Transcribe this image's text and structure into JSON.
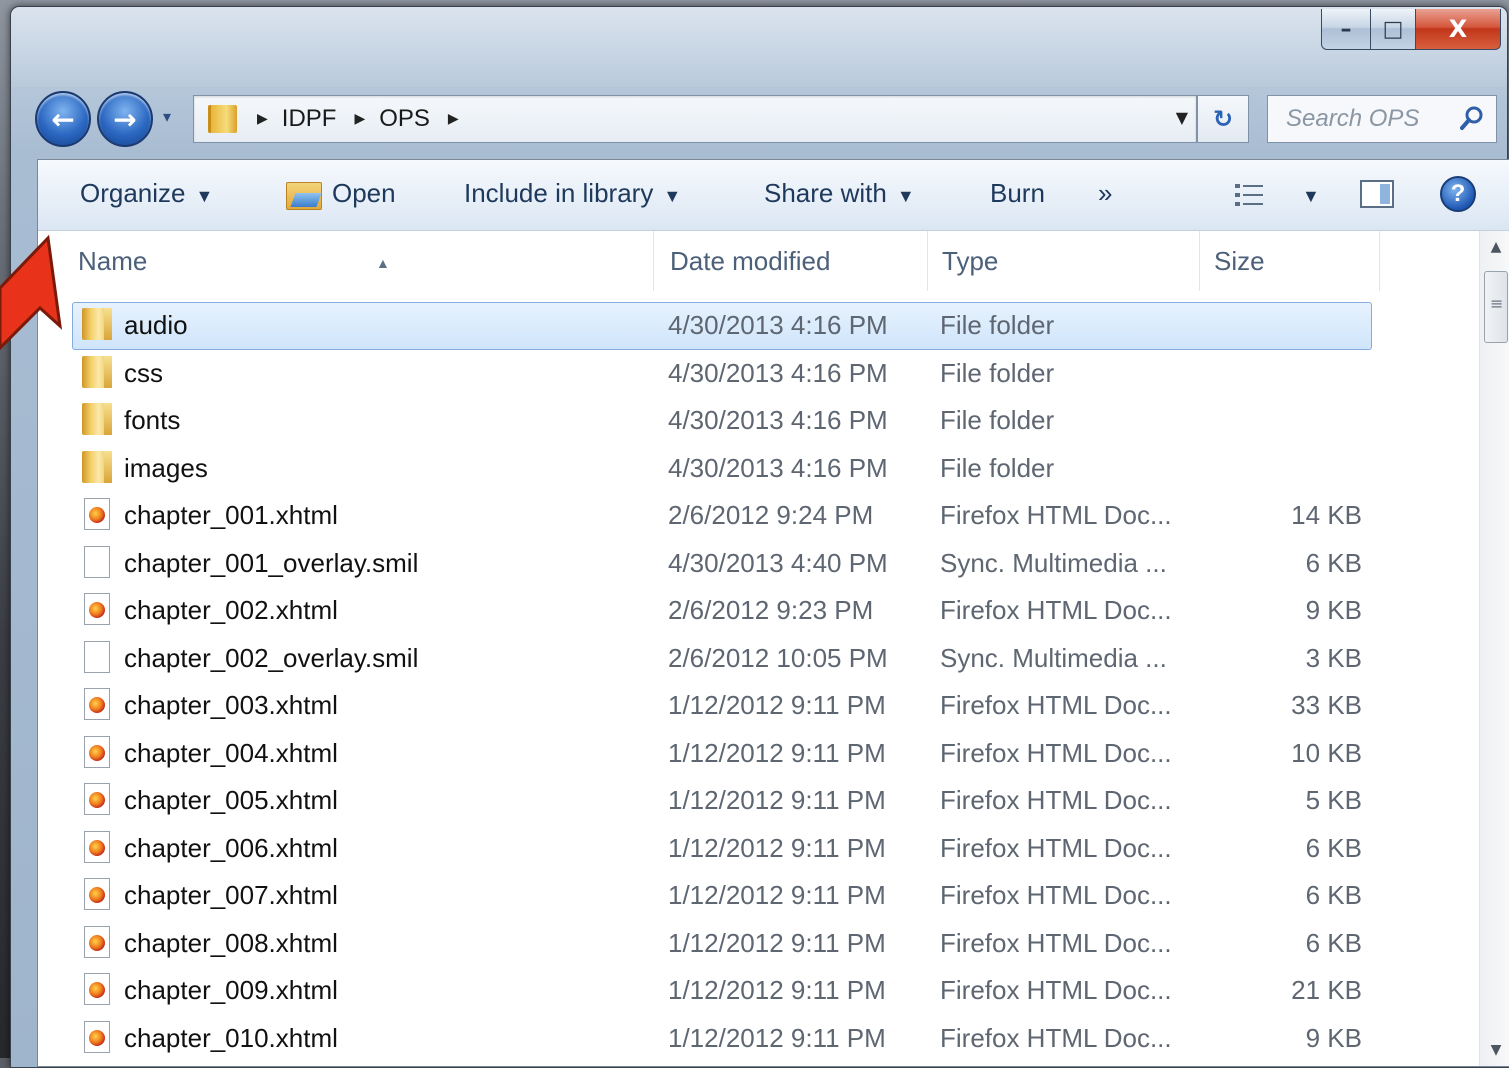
{
  "window": {
    "caption_min": "–",
    "caption_max": "□",
    "caption_close": "X"
  },
  "nav": {
    "back_glyph": "←",
    "forward_glyph": "→",
    "recent_glyph": "▾",
    "breadcrumb": [
      "IDPF",
      "OPS"
    ],
    "refresh_glyph": "↻",
    "search_placeholder": "Search OPS"
  },
  "toolbar": {
    "organize": "Organize",
    "open": "Open",
    "include_in_library": "Include in library",
    "share_with": "Share with",
    "burn": "Burn",
    "more": "»",
    "help_glyph": "?"
  },
  "columns": {
    "name": "Name",
    "date_modified": "Date modified",
    "type": "Type",
    "size": "Size"
  },
  "files": [
    {
      "name": "audio",
      "date": "4/30/2013 4:16 PM",
      "type": "File folder",
      "size": "",
      "icon": "folder-icon",
      "selected": true
    },
    {
      "name": "css",
      "date": "4/30/2013 4:16 PM",
      "type": "File folder",
      "size": "",
      "icon": "folder-icon"
    },
    {
      "name": "fonts",
      "date": "4/30/2013 4:16 PM",
      "type": "File folder",
      "size": "",
      "icon": "folder-icon"
    },
    {
      "name": "images",
      "date": "4/30/2013 4:16 PM",
      "type": "File folder",
      "size": "",
      "icon": "folder-icon"
    },
    {
      "name": "chapter_001.xhtml",
      "date": "2/6/2012 9:24 PM",
      "type": "Firefox HTML Doc...",
      "size": "14 KB",
      "icon": "firefox-document-icon"
    },
    {
      "name": "chapter_001_overlay.smil",
      "date": "4/30/2013 4:40 PM",
      "type": "Sync. Multimedia ...",
      "size": "6 KB",
      "icon": "blank-document-icon"
    },
    {
      "name": "chapter_002.xhtml",
      "date": "2/6/2012 9:23 PM",
      "type": "Firefox HTML Doc...",
      "size": "9 KB",
      "icon": "firefox-document-icon"
    },
    {
      "name": "chapter_002_overlay.smil",
      "date": "2/6/2012 10:05 PM",
      "type": "Sync. Multimedia ...",
      "size": "3 KB",
      "icon": "blank-document-icon"
    },
    {
      "name": "chapter_003.xhtml",
      "date": "1/12/2012 9:11 PM",
      "type": "Firefox HTML Doc...",
      "size": "33 KB",
      "icon": "firefox-document-icon"
    },
    {
      "name": "chapter_004.xhtml",
      "date": "1/12/2012 9:11 PM",
      "type": "Firefox HTML Doc...",
      "size": "10 KB",
      "icon": "firefox-document-icon"
    },
    {
      "name": "chapter_005.xhtml",
      "date": "1/12/2012 9:11 PM",
      "type": "Firefox HTML Doc...",
      "size": "5 KB",
      "icon": "firefox-document-icon"
    },
    {
      "name": "chapter_006.xhtml",
      "date": "1/12/2012 9:11 PM",
      "type": "Firefox HTML Doc...",
      "size": "6 KB",
      "icon": "firefox-document-icon"
    },
    {
      "name": "chapter_007.xhtml",
      "date": "1/12/2012 9:11 PM",
      "type": "Firefox HTML Doc...",
      "size": "6 KB",
      "icon": "firefox-document-icon"
    },
    {
      "name": "chapter_008.xhtml",
      "date": "1/12/2012 9:11 PM",
      "type": "Firefox HTML Doc...",
      "size": "6 KB",
      "icon": "firefox-document-icon"
    },
    {
      "name": "chapter_009.xhtml",
      "date": "1/12/2012 9:11 PM",
      "type": "Firefox HTML Doc...",
      "size": "21 KB",
      "icon": "firefox-document-icon"
    },
    {
      "name": "chapter_010.xhtml",
      "date": "1/12/2012 9:11 PM",
      "type": "Firefox HTML Doc...",
      "size": "9 KB",
      "icon": "firefox-document-icon"
    }
  ],
  "colors": {
    "selection": "#cfe5fb",
    "annotation_arrow": "#e8321a"
  }
}
